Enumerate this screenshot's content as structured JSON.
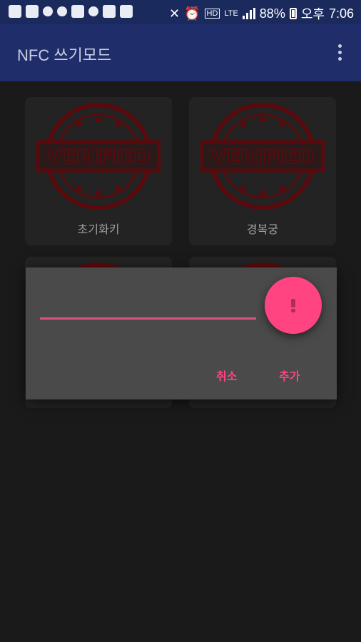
{
  "status_bar": {
    "battery_percent": "88%",
    "period": "오후",
    "time": "7:06",
    "volte_label": "HD",
    "lte_label": "LTE"
  },
  "app_bar": {
    "title": "NFC 쓰기모드",
    "menu_icon": "more-vert-icon"
  },
  "cards": [
    {
      "label": "초기화키",
      "badge_text": "VERIFIED"
    },
    {
      "label": "경복궁",
      "badge_text": "VERIFIED"
    }
  ],
  "dialog": {
    "input_value": "",
    "fab_icon": "exclamation-icon",
    "cancel_label": "취소",
    "add_label": "추가"
  },
  "colors": {
    "app_bar": "#1f2e6a",
    "accent": "#ff4481",
    "stamp": "#5a0a0c"
  }
}
